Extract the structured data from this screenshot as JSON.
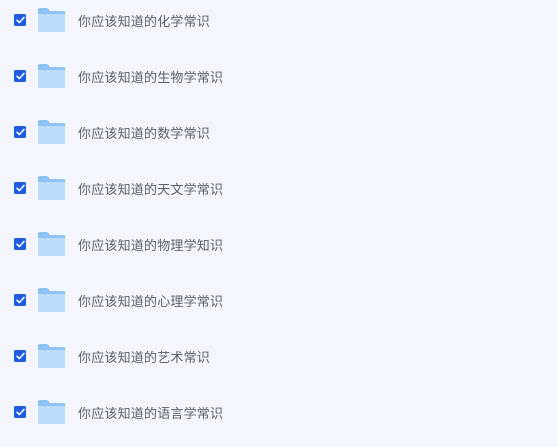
{
  "colors": {
    "background": "#f5f6fd",
    "checkbox": "#1f5ae6",
    "folder_light": "#bcdcfb",
    "folder_dark": "#8ec4f5",
    "text": "#5b5f6b"
  },
  "items": [
    {
      "name": "你应该知道的化学常识",
      "checked": true,
      "icon": "folder-icon"
    },
    {
      "name": "你应该知道的生物学常识",
      "checked": true,
      "icon": "folder-icon"
    },
    {
      "name": "你应该知道的数学常识",
      "checked": true,
      "icon": "folder-icon"
    },
    {
      "name": "你应该知道的天文学常识",
      "checked": true,
      "icon": "folder-icon"
    },
    {
      "name": "你应该知道的物理学知识",
      "checked": true,
      "icon": "folder-icon"
    },
    {
      "name": "你应该知道的心理学常识",
      "checked": true,
      "icon": "folder-icon"
    },
    {
      "name": "你应该知道的艺术常识",
      "checked": true,
      "icon": "folder-icon"
    },
    {
      "name": "你应该知道的语言学常识",
      "checked": true,
      "icon": "folder-icon"
    }
  ]
}
